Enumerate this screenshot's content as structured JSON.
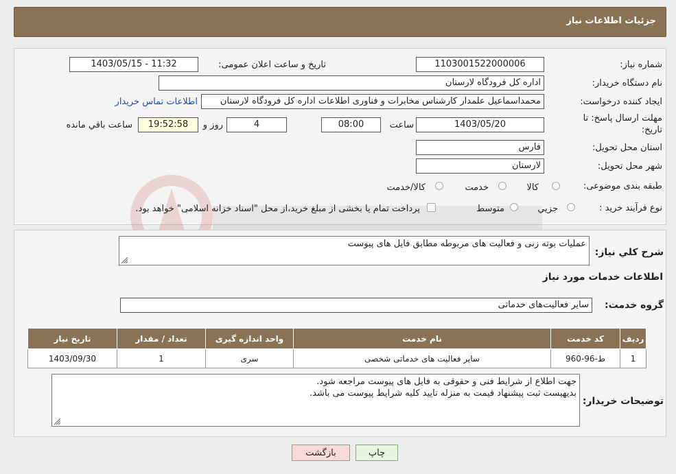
{
  "header": {
    "title": "جزئیات اطلاعات نیاز"
  },
  "need_number": {
    "label": "شماره نیاز:",
    "value": "1103001522000006"
  },
  "announce_datetime": {
    "label": "تاریخ و ساعت اعلان عمومی:",
    "value": "1403/05/15 - 11:32"
  },
  "buyer_org": {
    "label": "نام دستگاه خریدار:",
    "value": "اداره کل فرودگاه لارستان"
  },
  "requester": {
    "label": "ایجاد کننده درخواست:",
    "value": "محمداسماعیل علمدار کارشناس مخابرات و فناوری اطلاعات اداره کل فرودگاه لارستان",
    "contact_link": "اطلاعات تماس خریدار"
  },
  "deadline": {
    "label_line1": "مهلت ارسال پاسخ: تا",
    "label_line2": "تاریخ:",
    "date": "1403/05/20",
    "time_label": "ساعت",
    "time": "08:00",
    "days": "4",
    "days_label": "روز و",
    "remaining": "19:52:58",
    "remaining_label": "ساعت باقي مانده"
  },
  "province": {
    "label": "استان محل تحویل:",
    "value": "فارس"
  },
  "city": {
    "label": "شهر محل تحویل:",
    "value": "لارستان"
  },
  "category": {
    "label": "طبقه بندی موضوعی:",
    "options": [
      "کالا",
      "خدمت",
      "کالا/خدمت"
    ]
  },
  "purchase_process": {
    "label": "نوع فرآیند خرید :",
    "options": [
      "جزیي",
      "متوسط"
    ],
    "note": "پرداخت تمام یا بخشی از مبلغ خرید،از محل \"اسناد خزانه اسلامی\" خواهد بود."
  },
  "description": {
    "label": "شرح کلي نياز:",
    "value": "عملیات بوته زنی و فعالیت های مربوطه مطابق فایل های پیوست"
  },
  "services_section": {
    "title": "اطلاعات خدمات مورد نیاز"
  },
  "service_group": {
    "label": "گروه خدمت:",
    "value": "سایر فعالیت‌های خدماتی"
  },
  "table": {
    "headers": [
      "ردیف",
      "کد خدمت",
      "نام خدمت",
      "واحد اندازه گیری",
      "تعداد / مقدار",
      "تاریخ نیاز"
    ],
    "rows": [
      [
        "1",
        "ط-96-960",
        "سایر فعالیت های خدماتی شخصی",
        "سری",
        "1",
        "1403/09/30"
      ]
    ]
  },
  "buyer_notes": {
    "label": "توضیحات خریدار:",
    "line1": "جهت اطلاع از شرایط فنی و حقوقی به فایل های پیوست مراجعه شود.",
    "line2": "بدیهیست ثبت پیشنهاد قیمت به منزله تایید کلیه شرایط پیوست می باشد."
  },
  "buttons": {
    "print": "چاپ",
    "back": "بازگشت"
  },
  "colors": {
    "header_bg": "#8a7354",
    "link": "#1a4ea8",
    "print_btn": "#e6f5dd",
    "back_btn": "#f8dada"
  }
}
